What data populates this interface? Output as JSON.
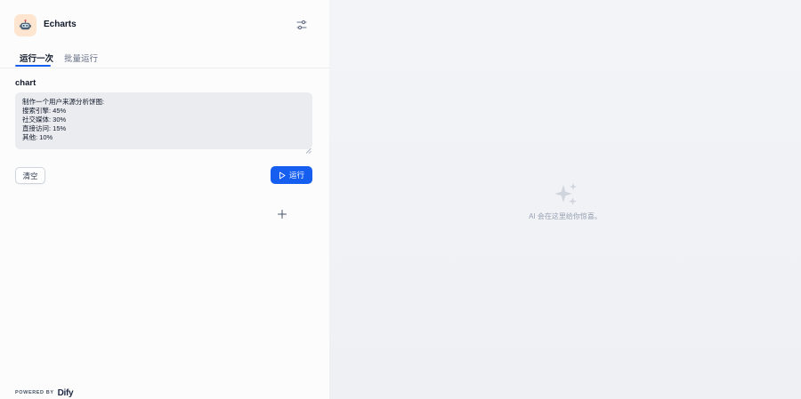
{
  "app": {
    "title": "Echarts",
    "icon": "robot-icon"
  },
  "header": {
    "settings_icon": "settings-sliders-icon"
  },
  "tabs": [
    {
      "label": "运行一次",
      "active": true
    },
    {
      "label": "批量运行",
      "active": false
    }
  ],
  "form": {
    "field_label": "chart",
    "textarea_value": "制作一个用户来源分析饼图:\n搜索引擎: 45%\n社交媒体: 30%\n直接访问: 15%\n其他: 10%"
  },
  "actions": {
    "clear_label": "清空",
    "run_label": "运行"
  },
  "footer": {
    "powered_by": "POWERED BY",
    "brand": "Dify"
  },
  "result_panel": {
    "empty_text": "AI 会在这里给你惊喜。",
    "icon": "sparkles-icon"
  },
  "colors": {
    "accent": "#155eef",
    "icon_bg": "#fde5cf"
  }
}
